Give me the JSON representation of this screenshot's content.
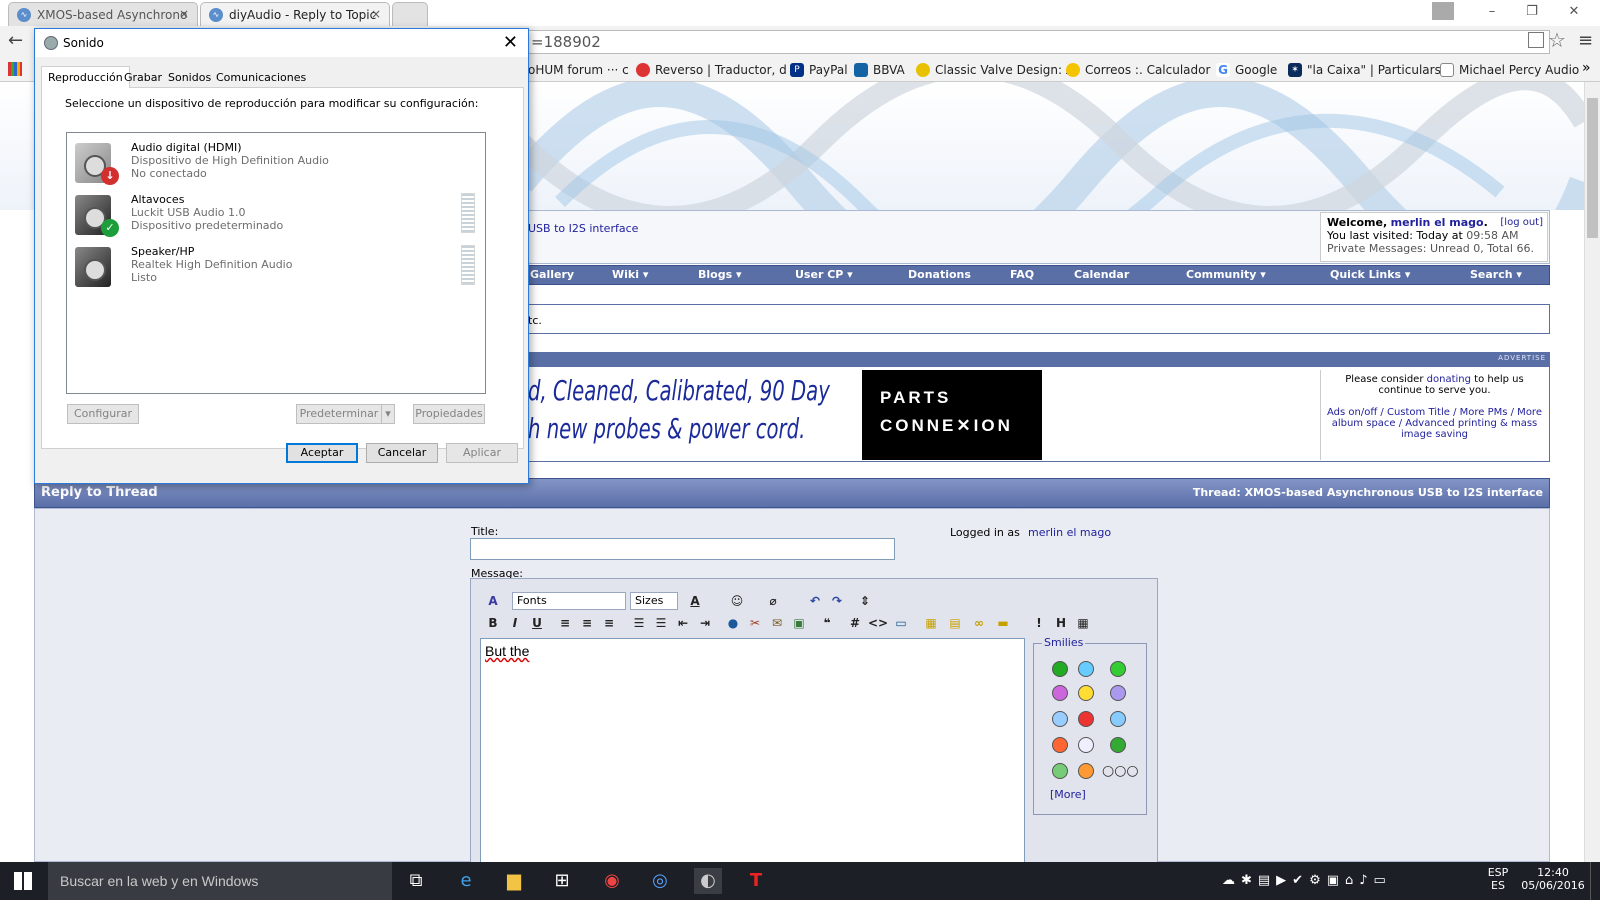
{
  "browser": {
    "tabs": [
      {
        "label": "XMOS-based Asynchrono",
        "close": "×"
      },
      {
        "label": "diyAudio - Reply to Topic",
        "close": "×"
      }
    ],
    "window_controls": {
      "minimize": "–",
      "restore": "❐",
      "close": "✕"
    },
    "back": "←",
    "address": "=188902",
    "star": "☆",
    "menu": "≡",
    "bookmarks": [
      "oHUM forum ··· c",
      "Reverso | Traductor, d",
      "PayPal",
      "BBVA",
      "Classic Valve Design: A",
      "Correos :. Calculador",
      "Google",
      "\"la Caixa\" | Particulars",
      "Michael Percy Audio"
    ],
    "bookmarks_overflow": "»"
  },
  "forum": {
    "thread_link": "USB to I2S interface",
    "welcome": {
      "prefix": "Welcome,",
      "user": "merlin el mago",
      "suffix": ".",
      "logout": "[log out]",
      "last_visited_label": "You last visited: Today at",
      "last_visited_time": "09:58 AM",
      "pm": "Private Messages: Unread 0, Total 66."
    },
    "nav": [
      "Gallery",
      "Wiki ▾",
      "Blogs ▾",
      "User CP ▾",
      "Donations",
      "FAQ",
      "Calendar",
      "Community ▾",
      "Quick Links ▾",
      "Search ▾"
    ],
    "notice_text": "tc.",
    "advertise": "ADVERTISE",
    "ad_line1": "d, Cleaned, Calibrated, 90 Day",
    "ad_line2": "h new probes & power cord.",
    "ad_brand_line1": "PARTS",
    "ad_brand_line2": "CONNE✕ION",
    "donate": {
      "pre": "Please consider",
      "link": "donating",
      "post": "to help us continue to serve you.",
      "extras": "Ads on/off / Custom Title / More PMs / More album space / Advanced printing & mass image saving"
    },
    "reply_title": "Reply to Thread",
    "thread_label": "Thread:",
    "thread_name": "XMOS-based Asynchronous USB to I2S interface",
    "title_label": "Title:",
    "logged_in_label": "Logged in as",
    "logged_in_user": "merlin el mago",
    "message_label": "Message:",
    "fonts": "Fonts",
    "sizes": "Sizes",
    "message_text": "But the",
    "smilies_label": "Smilies",
    "more_label": "[More]",
    "toolbar_glyphs": [
      "B",
      "I",
      "U",
      "≡",
      "≡",
      "≡",
      "☰",
      "☰",
      "⇤",
      "⇥",
      "#",
      "<>"
    ]
  },
  "dialog": {
    "title": "Sonido",
    "close": "✕",
    "tabs": [
      "Reproducción",
      "Grabar",
      "Sonidos",
      "Comunicaciones"
    ],
    "instruction": "Seleccione un dispositivo de reproducción para modificar su configuración:",
    "devices": [
      {
        "name": "Audio digital (HDMI)",
        "line2": "Dispositivo de High Definition Audio",
        "line3": "No conectado",
        "badge": "↓",
        "badge_color": "#d32f2f"
      },
      {
        "name": "Altavoces",
        "line2": "Luckit USB Audio 1.0",
        "line3": "Dispositivo predeterminado",
        "badge": "✓",
        "badge_color": "#1e9e3a"
      },
      {
        "name": "Speaker/HP",
        "line2": "Realtek High Definition Audio",
        "line3": "Listo"
      }
    ],
    "btn_configure": "Configurar",
    "btn_default": "Predeterminar",
    "btn_default_arrow": "▾",
    "btn_properties": "Propiedades",
    "btn_ok": "Aceptar",
    "btn_cancel": "Cancelar",
    "btn_apply": "Aplicar"
  },
  "taskbar": {
    "search": "Buscar en la web y en Windows",
    "lang_top": "ESP",
    "lang_bottom": "ES",
    "time": "12:40",
    "date": "05/06/2016"
  },
  "colors": {
    "accent": "#5a6fa6",
    "link": "#22229c",
    "dialog_border": "#2b7ad9",
    "taskbar": "#1c1f26"
  }
}
